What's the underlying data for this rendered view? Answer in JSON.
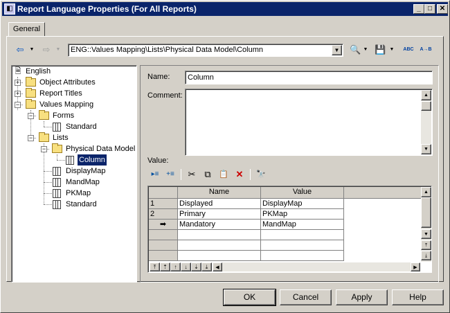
{
  "window": {
    "title": "Report Language Properties (For All Reports)",
    "minimize": "_",
    "maximize": "□",
    "close": "✕"
  },
  "tabs": [
    {
      "label": "General",
      "active": true
    }
  ],
  "toolbar": {
    "back_icon": "⇦",
    "forward_icon": "⇨",
    "dropdown_arrow": "▼",
    "path_value": "ENG::Values Mapping\\Lists\\Physical Data Model\\Column",
    "search_icon": "🔍",
    "save_icon": "💾",
    "spell_icon": "ABC",
    "translate_icon": "A→B"
  },
  "tree": {
    "items": [
      {
        "label": "English",
        "icon": "report-language-icon"
      },
      {
        "label": "Object Attributes",
        "icon": "folder-icon",
        "expander": "+"
      },
      {
        "label": "Report Titles",
        "icon": "folder-icon",
        "expander": "+"
      },
      {
        "label": "Values Mapping",
        "icon": "folder-icon",
        "expander": "−"
      },
      {
        "label": "Forms",
        "icon": "folder-icon",
        "expander": "−"
      },
      {
        "label": "Standard",
        "icon": "table-icon"
      },
      {
        "label": "Lists",
        "icon": "folder-icon",
        "expander": "−"
      },
      {
        "label": "Physical Data Model",
        "icon": "folder-icon",
        "expander": "−"
      },
      {
        "label": "Column",
        "icon": "table-icon",
        "selected": true
      },
      {
        "label": "DisplayMap",
        "icon": "table-icon"
      },
      {
        "label": "MandMap",
        "icon": "table-icon"
      },
      {
        "label": "PKMap",
        "icon": "table-icon"
      },
      {
        "label": "Standard",
        "icon": "table-icon"
      }
    ]
  },
  "form": {
    "name_label": "Name:",
    "name_value": "Column",
    "comment_label": "Comment:",
    "comment_value": "",
    "value_label": "Value:"
  },
  "grid_toolbar": {
    "insert_row_icon": "▸≡",
    "add_row_icon": "+≡",
    "cut_icon": "✂",
    "copy_icon": "⧉",
    "paste_icon": "📋",
    "delete_icon": "✕",
    "find_icon": "🔭"
  },
  "grid": {
    "columns": [
      "Name",
      "Value"
    ],
    "rows": [
      {
        "marker": "1",
        "name": "Displayed",
        "value": "DisplayMap"
      },
      {
        "marker": "2",
        "name": "Primary",
        "value": "PKMap"
      },
      {
        "marker": "➡",
        "name": "Mandatory",
        "value": "MandMap"
      }
    ],
    "move_buttons": [
      "⤒",
      "⇡",
      "↑",
      "↓",
      "⇣",
      "⤓"
    ]
  },
  "buttons": {
    "ok": "OK",
    "cancel": "Cancel",
    "apply": "Apply",
    "help": "Help"
  },
  "colors": {
    "titlebar": "#0a246a",
    "face": "#d4d0c8",
    "selection": "#0a246a",
    "delete_icon": "#cc0000"
  }
}
